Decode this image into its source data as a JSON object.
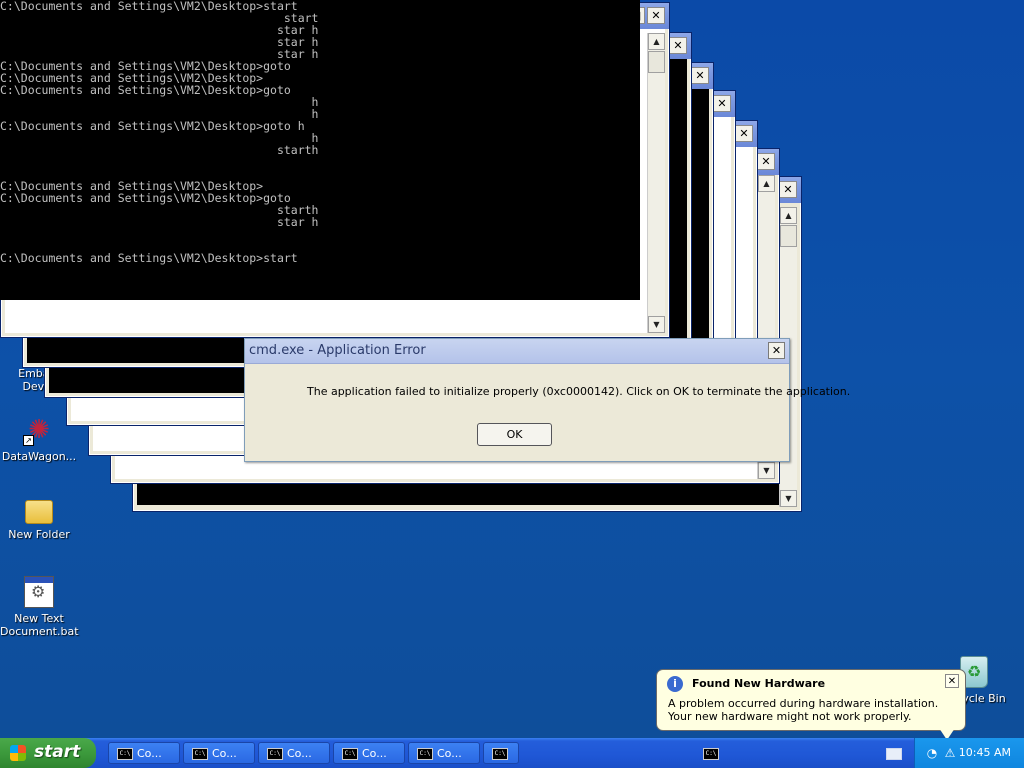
{
  "console": {
    "lines": [
      "C:\\Documents and Settings\\VM2\\Desktop>start",
      "                                         start",
      "                                        star h",
      "                                        star h",
      "                                        star h",
      "C:\\Documents and Settings\\VM2\\Desktop>goto",
      "C:\\Documents and Settings\\VM2\\Desktop>",
      "C:\\Documents and Settings\\VM2\\Desktop>goto",
      "                                             h",
      "                                             h",
      "C:\\Documents and Settings\\VM2\\Desktop>goto h",
      "                                             h",
      "                                        starth",
      "",
      "",
      "C:\\Documents and Settings\\VM2\\Desktop>",
      "C:\\Documents and Settings\\VM2\\Desktop>goto",
      "                                        starth",
      "                                        star h",
      "",
      "",
      "C:\\Documents and Settings\\VM2\\Desktop>start"
    ]
  },
  "desktop_icons": [
    {
      "label": "Embarc\nDev-C",
      "icon": "app-icon"
    },
    {
      "label": "DataWagon...",
      "icon": "datawagon-icon"
    },
    {
      "label": "New Folder",
      "icon": "folder-icon"
    },
    {
      "label": "New Text\nDocument.bat",
      "icon": "batch-file-icon"
    },
    {
      "label": "Recycle Bin",
      "icon": "recycle-bin-icon"
    }
  ],
  "error_dialog": {
    "title": "cmd.exe - Application Error",
    "message": "The application failed to initialize properly (0xc0000142). Click on OK to terminate the application.",
    "ok_label": "OK",
    "close_glyph": "✕"
  },
  "window_buttons": {
    "minimize": "_",
    "maximize": "□",
    "close": "✕"
  },
  "balloon": {
    "title": "Found New Hardware",
    "body": "A problem occurred during hardware installation. Your new hardware might not work properly.",
    "icon": "info-icon",
    "close_glyph": "✕"
  },
  "taskbar": {
    "start_label": "start",
    "buttons": [
      "Co...",
      "Co...",
      "Co...",
      "Co...",
      "Co...",
      "",
      ""
    ],
    "clock": "10:45 AM"
  },
  "colors": {
    "desktop": "#0d51a8",
    "taskbar": "#245edb",
    "start_button": "#3c9a3c",
    "tray": "#0f86df",
    "balloon": "#ffffe1"
  }
}
